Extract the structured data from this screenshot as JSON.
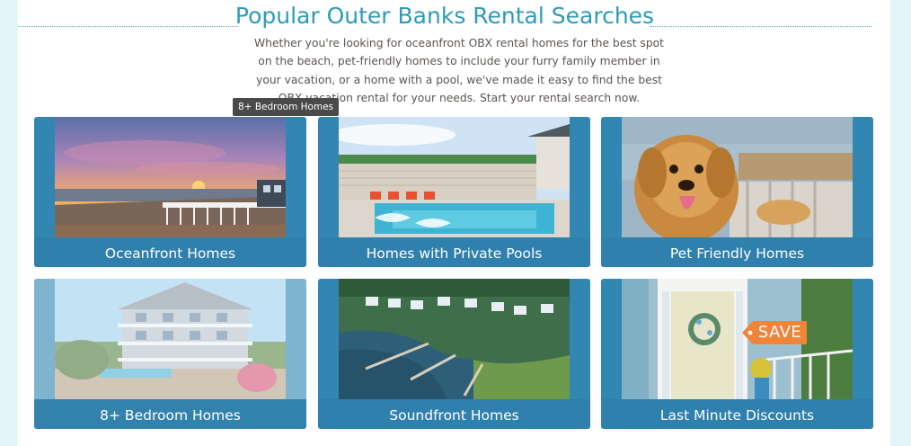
{
  "section": {
    "title": "Popular Outer Banks Rental Searches",
    "intro": "Whether you're looking for oceanfront OBX rental homes for the best spot on the beach, pet-friendly homes to include your furry family member in your vacation, or a home with a pool, we've made it easy to find the best OBX vacation rental for your needs. Start your rental search now."
  },
  "tooltip": "8+ Bedroom Homes",
  "cards": [
    {
      "label": "Oceanfront Homes",
      "image": "sunset-beach-deck"
    },
    {
      "label": "Homes with Private Pools",
      "image": "backyard-pool"
    },
    {
      "label": "Pet Friendly Homes",
      "image": "golden-retriever-puppy"
    },
    {
      "label": "8+ Bedroom Homes",
      "image": "large-beach-house"
    },
    {
      "label": "Soundfront Homes",
      "image": "aerial-soundfront-docks"
    },
    {
      "label": "Last Minute Discounts",
      "image": "front-door-wreath"
    }
  ],
  "save_badge": "SAVE",
  "colors": {
    "heading": "#2d9bb6",
    "card": "#3187b2",
    "badge": "#f0853a"
  }
}
